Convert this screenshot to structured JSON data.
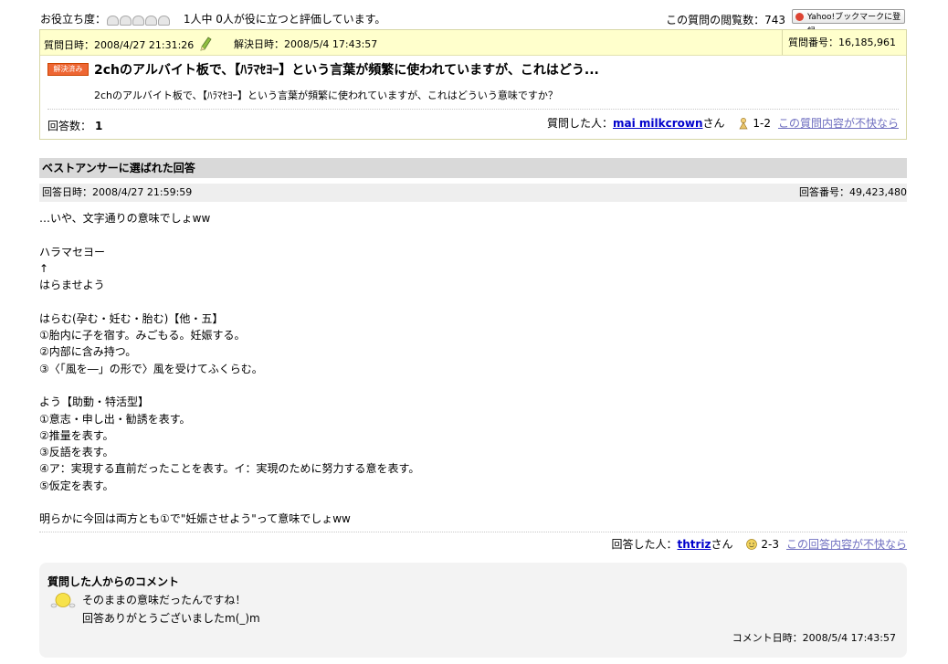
{
  "topbar": {
    "useful_label": "お役立ち度：",
    "useful_stars": 5,
    "useful_text": "1人中 0人が役に立つと評価しています。",
    "views": "この質問の閲覧数：743",
    "yahoo_bookmark": "Yahoo!ブックマークに登録"
  },
  "question": {
    "time": "質問日時：2008/4/27 21:31:26",
    "solved_time": "解決日時：2008/5/4 17:43:57",
    "number": "質問番号：16,185,961",
    "badge": "解決済み",
    "title": "2chのアルバイト板で、【ﾊﾗﾏｾﾖｰ】という言葉が頻繁に使われていますが、これはどう...",
    "body": "2chのアルバイト板で、【ﾊﾗﾏｾﾖｰ】という言葉が頻繁に使われていますが、これはどういう意味ですか？",
    "answer_count_label": "回答数：",
    "answer_count": "1",
    "asker_label": "質問した人：",
    "asker_name": "mai milkcrown",
    "asker_suffix": "さん",
    "asker_grade": "1-2",
    "report": "この質問内容が不快なら"
  },
  "best_answer": {
    "heading": "ベストアンサーに選ばれた回答",
    "time": "回答日時：2008/4/27 21:59:59",
    "number": "回答番号：49,423,480",
    "lines": [
      "…いや、文字通りの意味でしょww",
      "",
      "ハラマセヨー",
      "↑",
      "はらませよう",
      "",
      "はらむ(孕む・妊む・胎む)【他・五】",
      "①胎内に子を宿す。みごもる。妊娠する。",
      "②内部に含み持つ。",
      "③〈「風を―」の形で〉風を受けてふくらむ。",
      "",
      "よう【助動・特活型】",
      "①意志・申し出・勧誘を表す。",
      "②推量を表す。",
      "③反語を表す。",
      "④ア：実現する直前だったことを表す。イ：実現のために努力する意を表す。",
      "⑤仮定を表す。",
      "",
      "明らかに今回は両方とも①で\"妊娠させよう\"って意味でしょww"
    ],
    "answerer_label": "回答した人：",
    "answerer_name": "thtriz",
    "answerer_suffix": "さん",
    "answerer_grade": "2-3",
    "report": "この回答内容が不快なら"
  },
  "comment": {
    "title": "質問した人からのコメント",
    "line1": "そのままの意味だったんですね！",
    "line2": "回答ありがとうございましたm(_)m",
    "time": "コメント日時：2008/5/4 17:43:57"
  }
}
